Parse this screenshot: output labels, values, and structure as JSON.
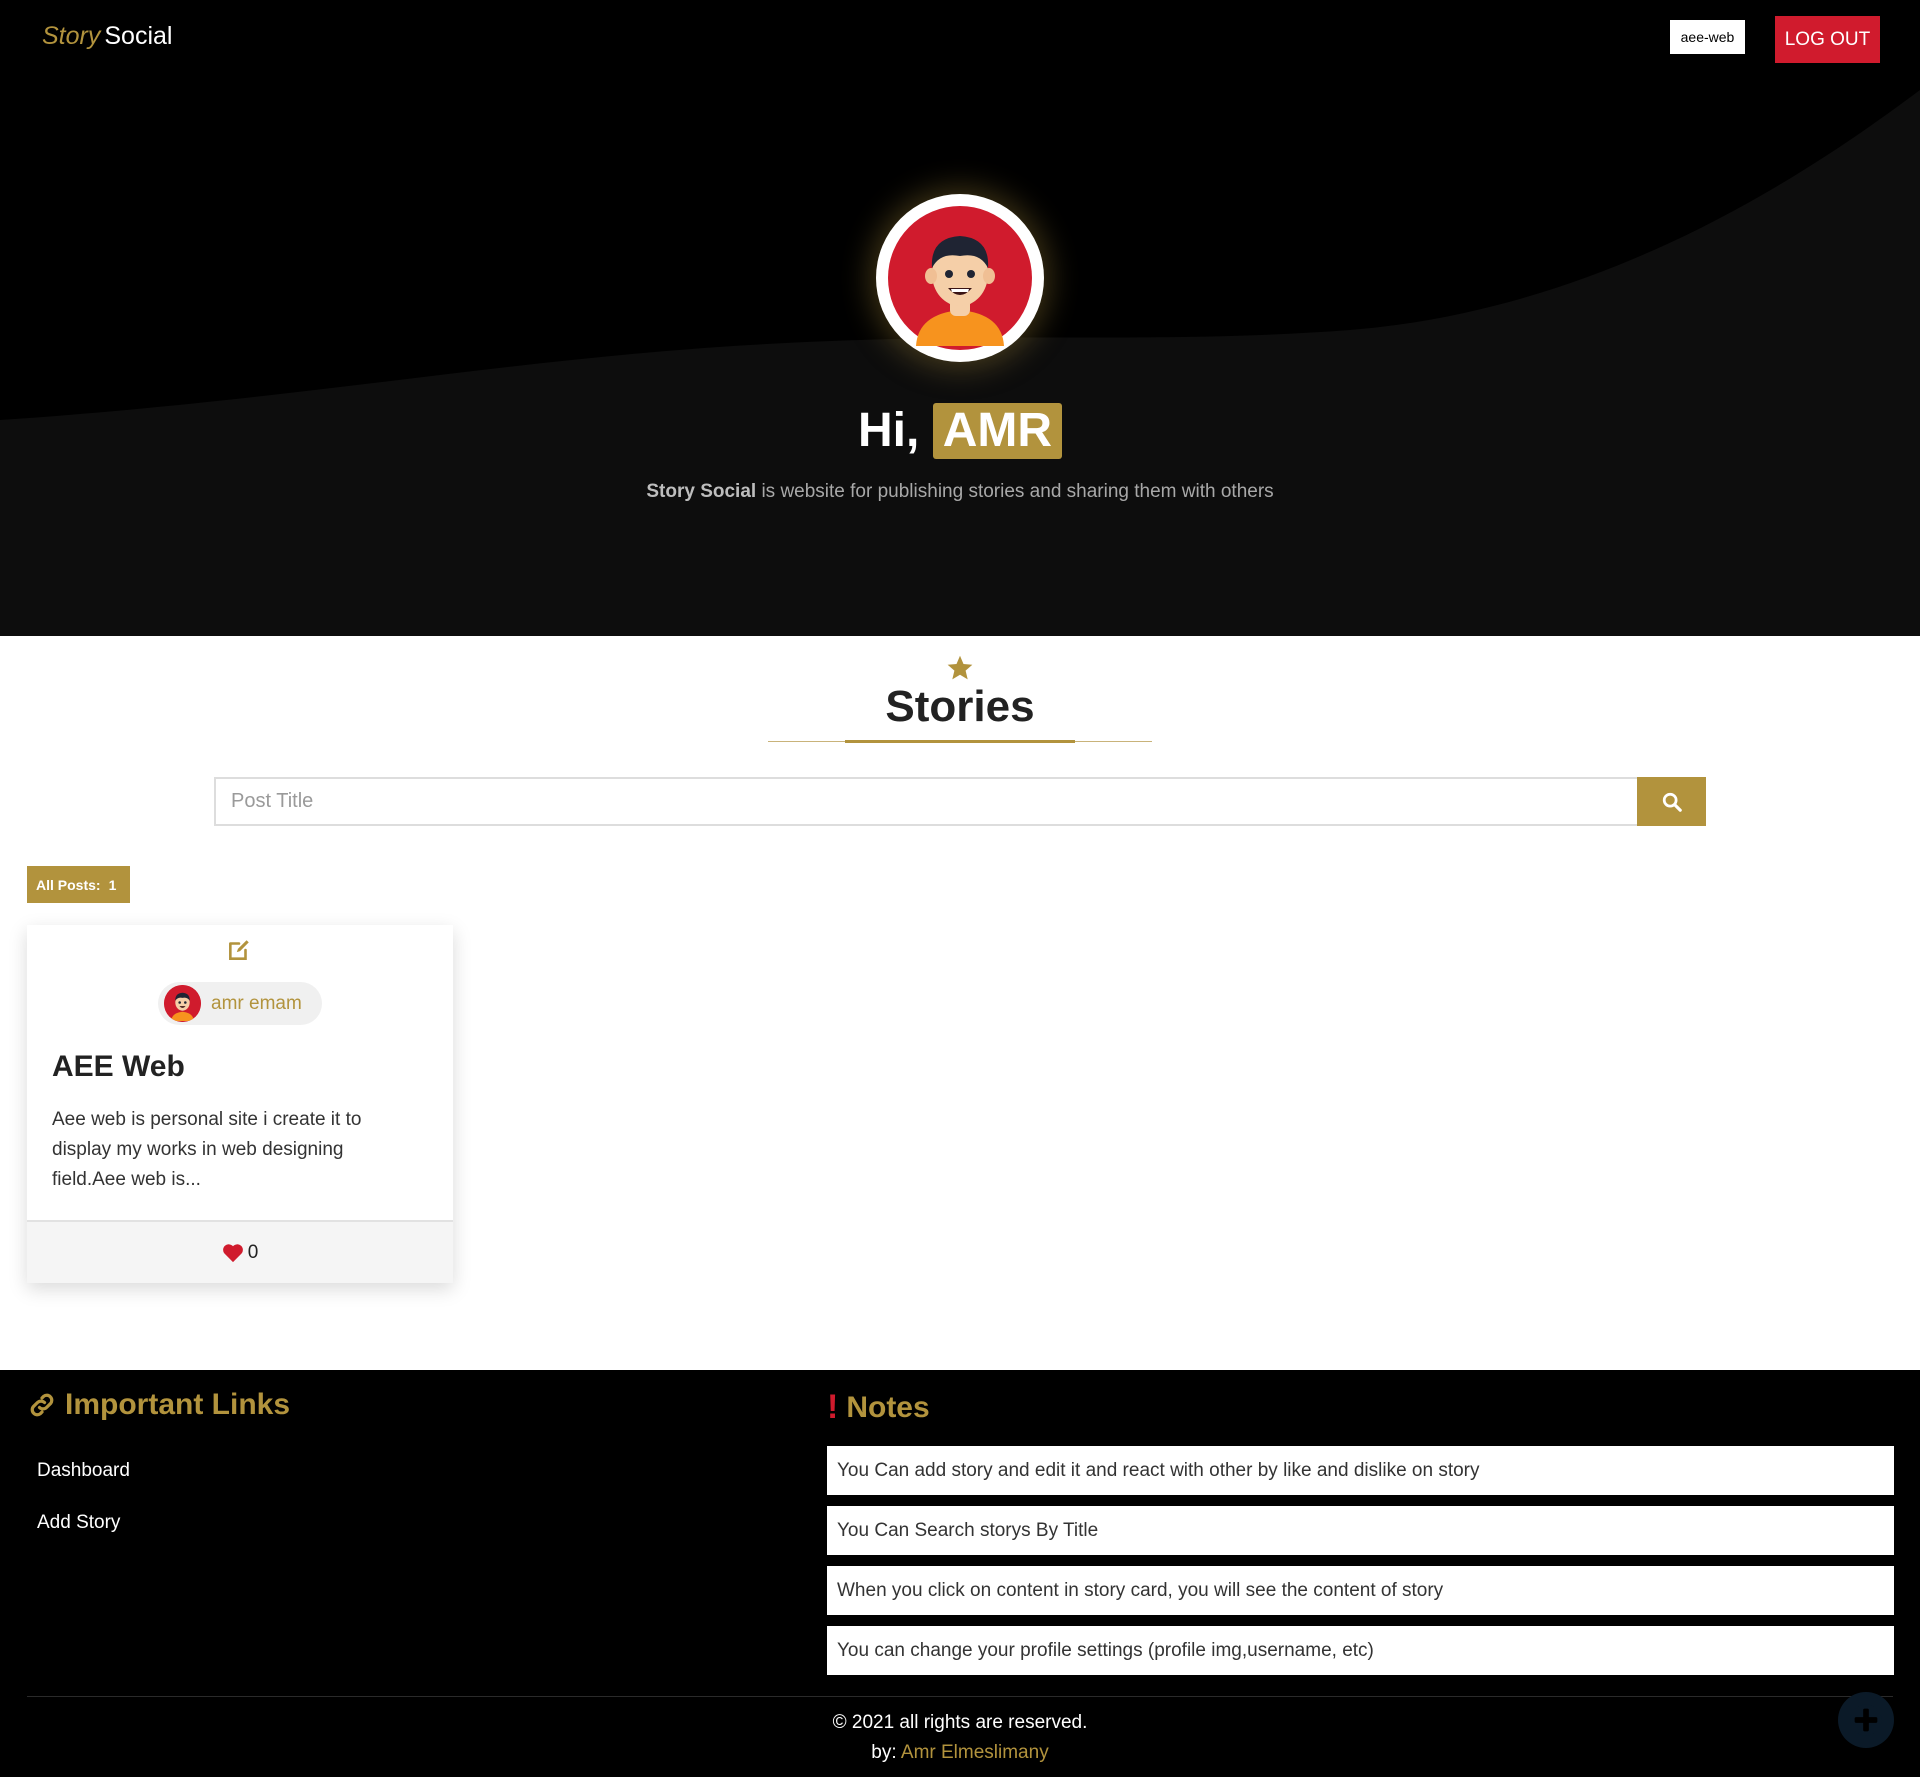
{
  "navbar": {
    "brand_story": "Story",
    "brand_social": "Social",
    "username_chip": "aee-web",
    "logout_label": "LOG OUT"
  },
  "hero": {
    "greeting_prefix": "Hi,",
    "greeting_name": "AMR",
    "tagline_brand": "Story Social",
    "tagline_rest": " is website for publishing stories and sharing them with others"
  },
  "stories": {
    "title": "Stories",
    "search_placeholder": "Post Title",
    "posts_badge_label": "All Posts:",
    "posts_badge_count": "1",
    "cards": [
      {
        "author": "amr emam",
        "title": "AEE Web",
        "excerpt": "Aee web is personal site i create it to display my works in web designing field.Aee web is...",
        "likes": "0"
      }
    ]
  },
  "footer": {
    "links_title": "Important Links",
    "links": [
      "Dashboard",
      "Add Story"
    ],
    "notes_title": "Notes",
    "notes": [
      "You Can add story and edit it and react with other by like and dislike on story",
      "You Can Search storys By Title",
      "When you click on content in story card, you will see the content of story",
      "You can change your profile settings (profile img,username, etc)"
    ],
    "copyright": "© 2021 all rights are reserved.",
    "by_label": "by:",
    "by_author": "Amr Elmeslimany"
  },
  "colors": {
    "accent_gold": "#b2933d",
    "danger_red": "#d01b2d",
    "background_dark": "#000000"
  },
  "icons": [
    "star-icon",
    "search-icon",
    "edit-icon",
    "heart-icon",
    "link-icon",
    "exclamation-icon",
    "plus-icon",
    "avatar-icon"
  ]
}
